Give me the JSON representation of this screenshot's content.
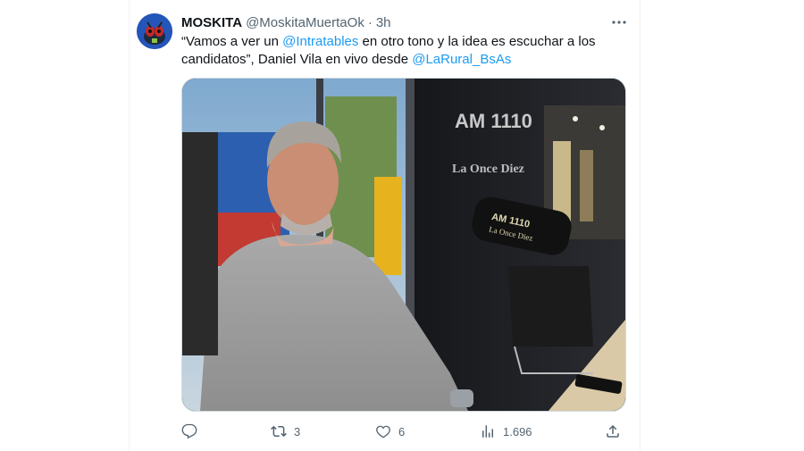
{
  "tweet": {
    "author_name": "MOSKITA",
    "author_handle": "@MoskitaMuertaOk",
    "separator": "·",
    "time": "3h",
    "text_part1": "“Vamos a ver un ",
    "mention1": "@Intratables",
    "text_part2": " en otro tono y la idea es escuchar a los candidatos”, Daniel Vila en vivo desde ",
    "mention2": "@LaRural_BsAs",
    "media_signage": [
      "AM 1110",
      "La Once Diez"
    ],
    "mic_flag": [
      "AM 1110",
      "La Once Diez"
    ]
  },
  "actions": {
    "reply_count": "",
    "retweet_count": "3",
    "like_count": "6",
    "view_count": "1.696"
  },
  "icons": {
    "more": "more-dots-icon",
    "reply": "reply-icon",
    "retweet": "retweet-icon",
    "like": "heart-icon",
    "views": "views-icon",
    "share": "share-icon"
  },
  "colors": {
    "accent": "#1d9bf0",
    "muted": "#536471",
    "text": "#0f1419"
  }
}
